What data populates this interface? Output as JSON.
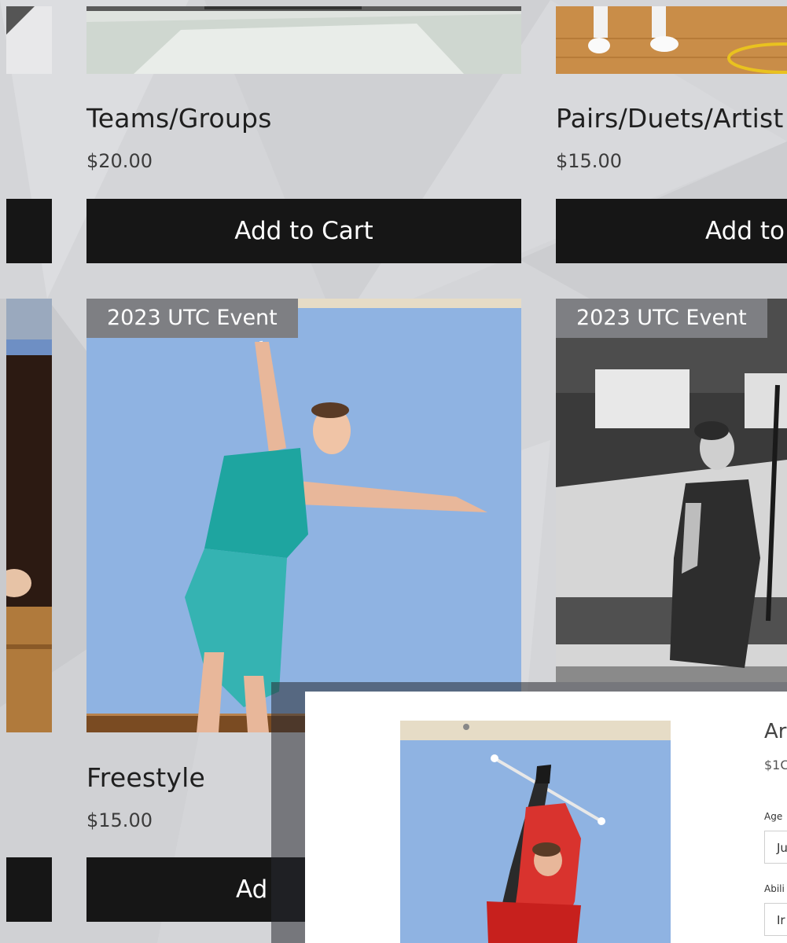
{
  "products": [
    {
      "title": "Teams/Groups",
      "price": "$20.00",
      "button": "Add to Cart"
    },
    {
      "title": "Pairs/Duets/Artist",
      "price": "$15.00",
      "button": "Add to"
    },
    {
      "ribbon": "2023 UTC Event",
      "title": "Freestyle",
      "price": "$15.00",
      "button": "Ad"
    },
    {
      "ribbon": "2023 UTC Event"
    }
  ],
  "quick_view": {
    "title": "Ar",
    "price": "$1C",
    "age_label": "Age",
    "age_value": "Ju",
    "ability_label": "Abili",
    "ability_value": "Ir"
  },
  "colors": {
    "button_bg": "#161616",
    "ribbon_bg": "#7e7f83",
    "background": "#d4d5d8"
  }
}
